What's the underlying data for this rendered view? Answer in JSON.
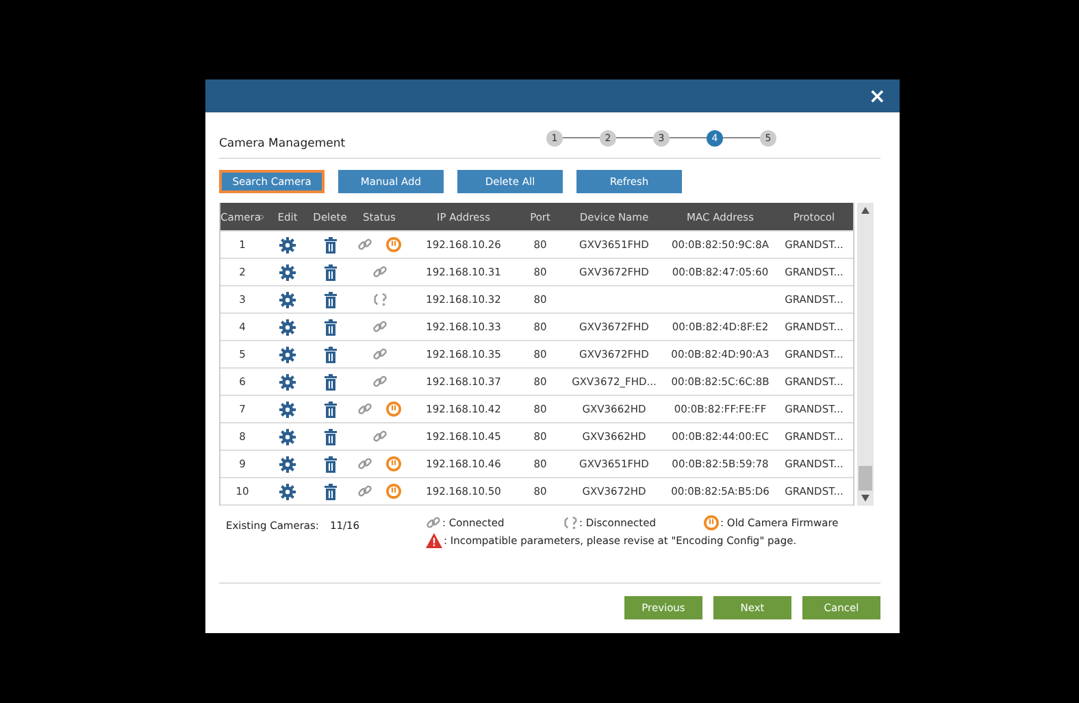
{
  "dialog": {
    "title": "Camera Management",
    "close": "×"
  },
  "steps": [
    {
      "label": "1",
      "selected": false
    },
    {
      "label": "2",
      "selected": false
    },
    {
      "label": "3",
      "selected": false
    },
    {
      "label": "4",
      "selected": true
    },
    {
      "label": "5",
      "selected": false
    }
  ],
  "toolbar": [
    {
      "label": "Search Camera",
      "selected": true
    },
    {
      "label": "Manual Add",
      "selected": false
    },
    {
      "label": "Delete All",
      "selected": false
    },
    {
      "label": "Refresh",
      "selected": false
    }
  ],
  "table": {
    "columns": [
      "Camera",
      "Edit",
      "Delete",
      "Status",
      "IP Address",
      "Port",
      "Device Name",
      "MAC Address",
      "Protocol"
    ],
    "rows": [
      {
        "camera": "1",
        "connected": true,
        "old_firmware": true,
        "ip": "192.168.10.26",
        "port": "80",
        "device": "GXV3651FHD",
        "mac": "00:0B:82:50:9C:8A",
        "protocol": "GRANDST..."
      },
      {
        "camera": "2",
        "connected": true,
        "old_firmware": false,
        "ip": "192.168.10.31",
        "port": "80",
        "device": "GXV3672FHD",
        "mac": "00:0B:82:47:05:60",
        "protocol": "GRANDST..."
      },
      {
        "camera": "3",
        "connected": false,
        "old_firmware": false,
        "ip": "192.168.10.32",
        "port": "80",
        "device": "",
        "mac": "",
        "protocol": "GRANDST..."
      },
      {
        "camera": "4",
        "connected": true,
        "old_firmware": false,
        "ip": "192.168.10.33",
        "port": "80",
        "device": "GXV3672FHD",
        "mac": "00:0B:82:4D:8F:E2",
        "protocol": "GRANDST..."
      },
      {
        "camera": "5",
        "connected": true,
        "old_firmware": false,
        "ip": "192.168.10.35",
        "port": "80",
        "device": "GXV3672FHD",
        "mac": "00:0B:82:4D:90:A3",
        "protocol": "GRANDST..."
      },
      {
        "camera": "6",
        "connected": true,
        "old_firmware": false,
        "ip": "192.168.10.37",
        "port": "80",
        "device": "GXV3672_FHD...",
        "mac": "00:0B:82:5C:6C:8B",
        "protocol": "GRANDST..."
      },
      {
        "camera": "7",
        "connected": true,
        "old_firmware": true,
        "ip": "192.168.10.42",
        "port": "80",
        "device": "GXV3662HD",
        "mac": "00:0B:82:FF:FE:FF",
        "protocol": "GRANDST..."
      },
      {
        "camera": "8",
        "connected": true,
        "old_firmware": false,
        "ip": "192.168.10.45",
        "port": "80",
        "device": "GXV3662HD",
        "mac": "00:0B:82:44:00:EC",
        "protocol": "GRANDST..."
      },
      {
        "camera": "9",
        "connected": true,
        "old_firmware": true,
        "ip": "192.168.10.46",
        "port": "80",
        "device": "GXV3651FHD",
        "mac": "00:0B:82:5B:59:78",
        "protocol": "GRANDST..."
      },
      {
        "camera": "10",
        "connected": true,
        "old_firmware": true,
        "ip": "192.168.10.50",
        "port": "80",
        "device": "GXV3672HD",
        "mac": "00:0B:82:5A:B5:D6",
        "protocol": "GRANDST..."
      }
    ]
  },
  "existing": {
    "label": "Existing Cameras:",
    "value": "11/16"
  },
  "legend": [
    {
      "kind": "connected",
      "label": ": Connected"
    },
    {
      "kind": "disconnected",
      "label": ": Disconnected"
    },
    {
      "kind": "old",
      "label": ": Old Camera Firmware"
    },
    {
      "kind": "warning",
      "label": ": Incompatible parameters, please revise at \"Encoding Config\" page."
    }
  ],
  "footer": [
    "Previous",
    "Next",
    "Cancel"
  ]
}
